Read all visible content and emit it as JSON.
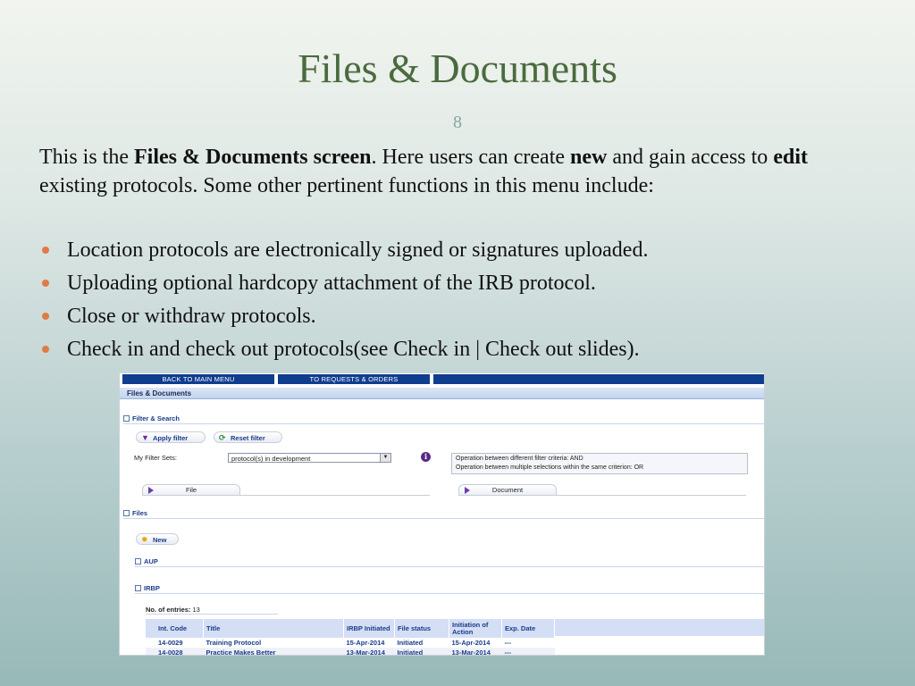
{
  "slide": {
    "title": "Files & Documents",
    "number": "8",
    "intro": {
      "t1": "This is the ",
      "b1": "Files & Documents screen",
      "t2": ". Here users can create ",
      "b2": "new",
      "t3": " and gain access to ",
      "b3": "edit",
      "t4": " existing protocols. Some other pertinent functions in this menu include:"
    },
    "bullets": [
      "Location protocols are electronically signed or signatures uploaded.",
      "Uploading optional hardcopy attachment of the IRB protocol.",
      "Close or withdraw protocols.",
      "Check in and check out protocols(see Check in | Check out slides)."
    ]
  },
  "app": {
    "nav": {
      "back": "BACK TO MAIN MENU",
      "requests": "TO REQUESTS & ORDERS"
    },
    "header": "Files & Documents",
    "filter": {
      "section": "Filter & Search",
      "apply": "Apply filter",
      "reset": "Reset filter",
      "sets_label": "My Filter Sets:",
      "sets_value": "protocol(s) in development",
      "info_line1": "Operation between different filter criteria: AND",
      "info_line2": "Operation between multiple selections within the same criterion: OR",
      "tab_file": "File",
      "tab_document": "Document"
    },
    "files": {
      "section": "Files",
      "new": "New",
      "aup": "AUP",
      "irbp": "IRBP",
      "entries_label": "No. of entries:",
      "entries_value": "13"
    },
    "table": {
      "headers": [
        "Int. Code",
        "Title",
        "IRBP Initiated",
        "File status",
        "Initiation of Action",
        "Exp. Date"
      ],
      "rows": [
        [
          "14-0029",
          "Training Protocol",
          "15-Apr-2014",
          "Initiated",
          "15-Apr-2014",
          "---"
        ],
        [
          "14-0028",
          "Practice Makes Better",
          "13-Mar-2014",
          "Initiated",
          "13-Mar-2014",
          "---"
        ]
      ]
    }
  }
}
